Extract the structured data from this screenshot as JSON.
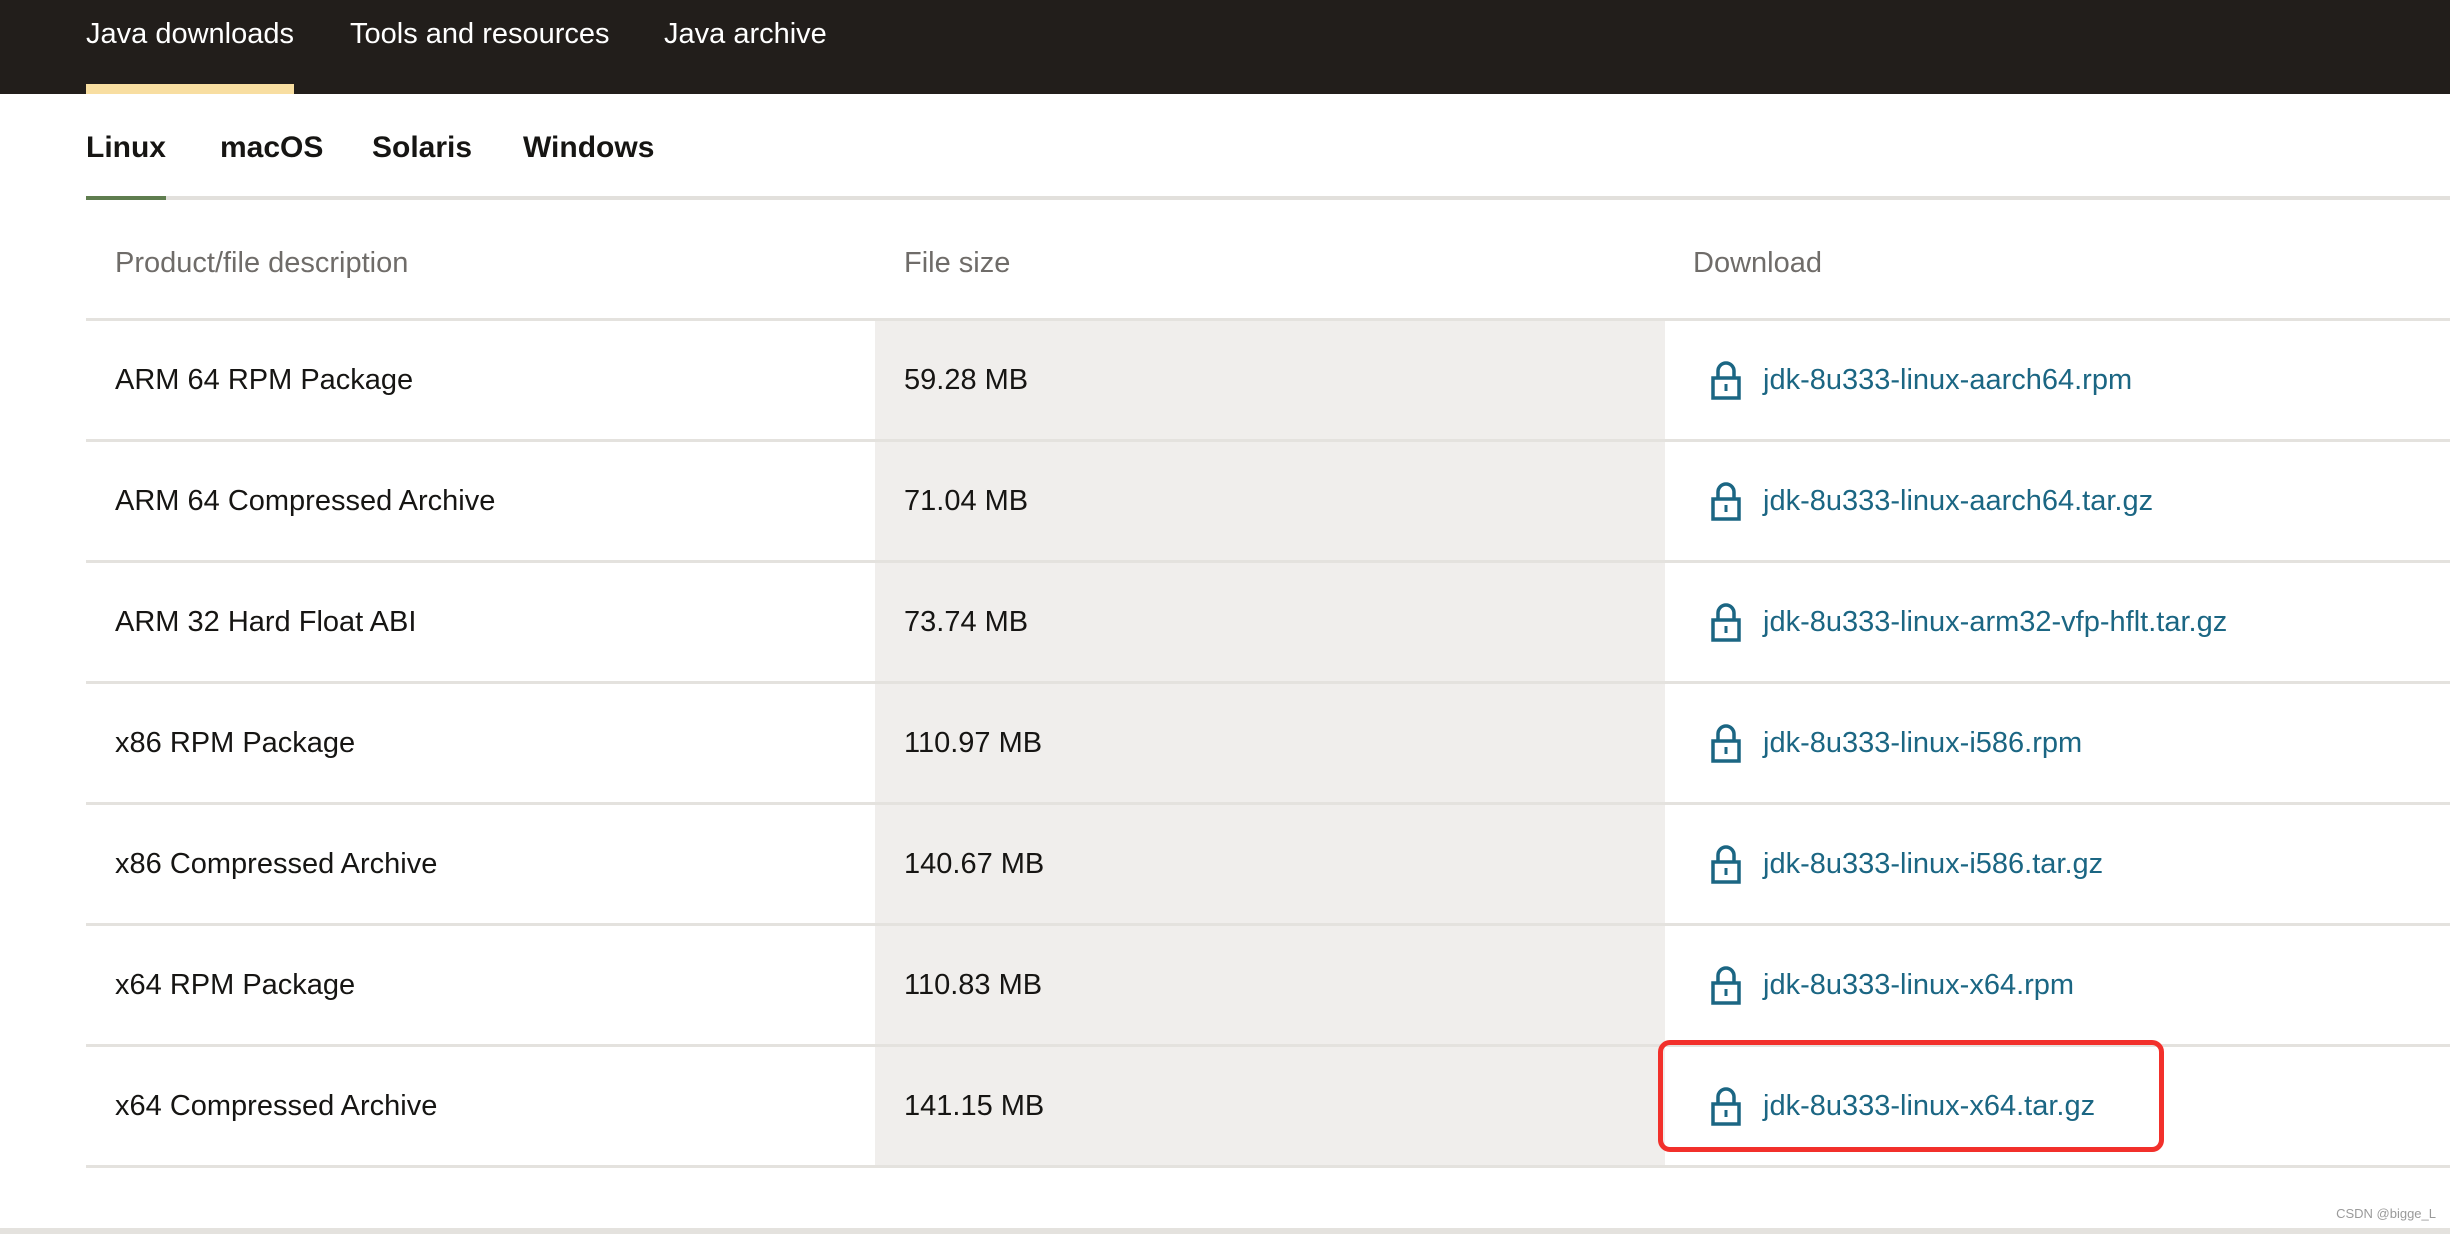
{
  "top_nav": {
    "items": [
      {
        "label": "Java downloads",
        "active": true
      },
      {
        "label": "Tools and resources",
        "active": false
      },
      {
        "label": "Java archive",
        "active": false
      }
    ],
    "active_underline_color": "#f8dea1",
    "background_color": "#221e1b"
  },
  "os_tabs": {
    "items": [
      {
        "label": "Linux",
        "active": true
      },
      {
        "label": "macOS",
        "active": false
      },
      {
        "label": "Solaris",
        "active": false
      },
      {
        "label": "Windows",
        "active": false
      }
    ],
    "active_underline_color": "#5f7d4f"
  },
  "table": {
    "headers": {
      "description": "Product/file description",
      "size": "File size",
      "download": "Download"
    },
    "rows": [
      {
        "description": "ARM 64 RPM Package",
        "size": "59.28 MB",
        "file": "jdk-8u333-linux-aarch64.rpm"
      },
      {
        "description": "ARM 64 Compressed Archive",
        "size": "71.04 MB",
        "file": "jdk-8u333-linux-aarch64.tar.gz"
      },
      {
        "description": "ARM 32 Hard Float ABI",
        "size": "73.74 MB",
        "file": "jdk-8u333-linux-arm32-vfp-hflt.tar.gz"
      },
      {
        "description": "x86 RPM Package",
        "size": "110.97 MB",
        "file": "jdk-8u333-linux-i586.rpm"
      },
      {
        "description": "x86 Compressed Archive",
        "size": "140.67 MB",
        "file": "jdk-8u333-linux-i586.tar.gz"
      },
      {
        "description": "x64 RPM Package",
        "size": "110.83 MB",
        "file": "jdk-8u333-linux-x64.rpm"
      },
      {
        "description": "x64 Compressed Archive",
        "size": "141.15 MB",
        "file": "jdk-8u333-linux-x64.tar.gz"
      }
    ],
    "link_icon": "lock-icon",
    "link_color": "#1b6683"
  },
  "annotation": {
    "highlighted_file": "jdk-8u333-linux-x64.tar.gz",
    "color": "#f2302b"
  },
  "watermark": "CSDN @bigge_L"
}
